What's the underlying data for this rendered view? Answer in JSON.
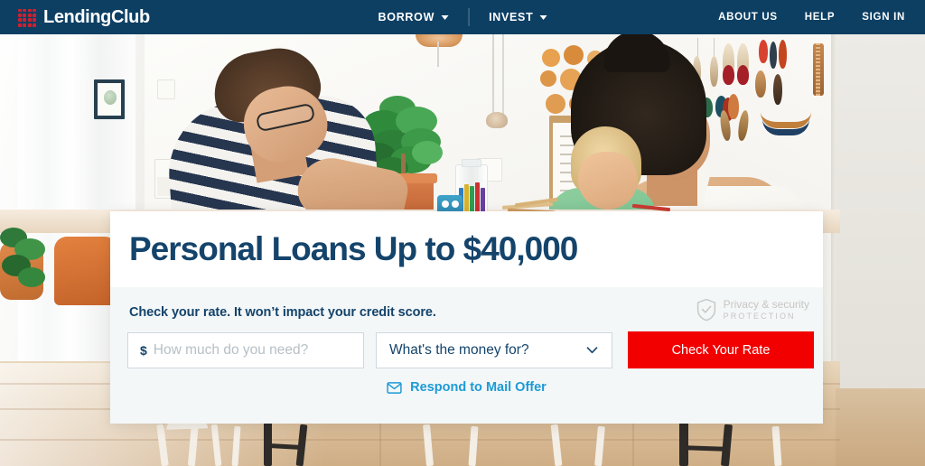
{
  "header": {
    "logo": {
      "mark_icon": "lendingclub-grid-icon",
      "mark_color": "#d0202f",
      "text": "LendingClub"
    },
    "background_color": "#0d3f63",
    "nav_primary": [
      {
        "label": "BORROW",
        "caret_icon": "caret-down-icon",
        "has_caret": true
      },
      {
        "label": "INVEST",
        "caret_icon": "caret-down-icon",
        "has_caret": true
      }
    ],
    "nav_secondary": [
      {
        "label": "ABOUT US"
      },
      {
        "label": "HELP"
      },
      {
        "label": "SIGN IN"
      }
    ]
  },
  "hero": {
    "headline": "Personal Loans Up to $40,000",
    "headline_color": "#14446b",
    "subhead": "Check your rate. It won’t impact your credit score.",
    "privacy_badge": {
      "icon": "shield-check-icon",
      "line1": "Privacy & security",
      "line2": "PROTECTION"
    },
    "form": {
      "amount": {
        "prefix": "$",
        "value": "",
        "placeholder": "How much do you need?"
      },
      "purpose": {
        "selected": "What's the money for?",
        "chevron_icon": "chevron-down-icon"
      },
      "submit": {
        "label": "Check Your Rate",
        "color": "#f20000"
      }
    },
    "mail_offer": {
      "icon": "envelope-icon",
      "label": "Respond to Mail Offer",
      "color": "#1c9ad6"
    }
  },
  "photo": {
    "alt": "family-at-table-photo"
  }
}
